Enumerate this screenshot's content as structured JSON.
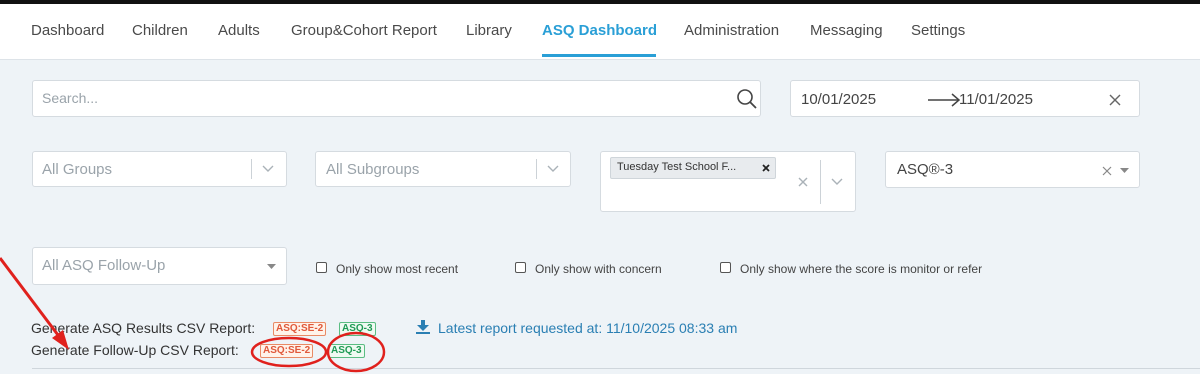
{
  "nav": {
    "tabs": [
      {
        "label": "Dashboard"
      },
      {
        "label": "Children"
      },
      {
        "label": "Adults"
      },
      {
        "label": "Group&Cohort Report"
      },
      {
        "label": "Library"
      },
      {
        "label": "ASQ Dashboard",
        "active": true
      },
      {
        "label": "Administration"
      },
      {
        "label": "Messaging"
      },
      {
        "label": "Settings"
      }
    ]
  },
  "search": {
    "placeholder": "Search...",
    "value": ""
  },
  "date_range": {
    "start": "10/01/2025",
    "end": "11/01/2025"
  },
  "filters": {
    "groups_placeholder": "All Groups",
    "subgroups_placeholder": "All Subgroups",
    "school_tag": "Tuesday Test School F...",
    "assessment": "ASQ®-3",
    "followup_placeholder": "All ASQ Follow-Up"
  },
  "checkboxes": [
    {
      "label": "Only show most recent",
      "checked": false
    },
    {
      "label": "Only show with concern",
      "checked": false
    },
    {
      "label": "Only show where the score is monitor or refer",
      "checked": false
    }
  ],
  "reports": {
    "results_label": "Generate ASQ Results CSV Report:",
    "followup_label": "Generate Follow-Up CSV Report:",
    "badge_se2": "ASQ:SE-2",
    "badge_asq3": "ASQ-3",
    "latest": "Latest report requested at: 11/10/2025 08:33 am"
  },
  "colors": {
    "accent": "#2a9fd6",
    "annotation": "#e0211d",
    "se2_badge": "#e0593b",
    "asq3_badge": "#1f9b55"
  }
}
